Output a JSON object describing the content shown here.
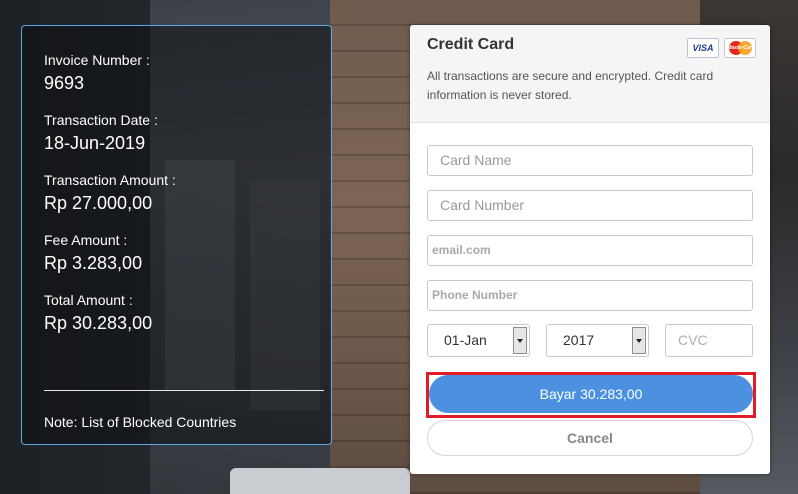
{
  "invoice": {
    "invoice_number_label": "Invoice Number :",
    "invoice_number": "9693",
    "transaction_date_label": "Transaction Date :",
    "transaction_date": "18-Jun-2019",
    "transaction_amount_label": "Transaction Amount :",
    "transaction_amount": "Rp 27.000,00",
    "fee_amount_label": "Fee Amount :",
    "fee_amount": "Rp 3.283,00",
    "total_amount_label": "Total Amount :",
    "total_amount": "Rp 30.283,00",
    "note": "Note: List of Blocked Countries"
  },
  "card": {
    "title": "Credit Card",
    "subtitle": "All transactions are secure and encrypted. Credit card information is never stored.",
    "visa_logo_text": "VISA",
    "mastercard_logo_text": "MasterCard",
    "card_name_placeholder": "Card Name",
    "card_number_placeholder": "Card Number",
    "email_placeholder": "email.com",
    "phone_placeholder": "Phone Number",
    "month_value": "01-Jan",
    "year_value": "2017",
    "cvc_placeholder": "CVC",
    "pay_button": "Bayar 30.283,00",
    "cancel_button": "Cancel"
  },
  "colors": {
    "invoice_border": "#5aa9e6",
    "pay_button": "#4b91e0",
    "highlight_outline": "#e01d26"
  }
}
